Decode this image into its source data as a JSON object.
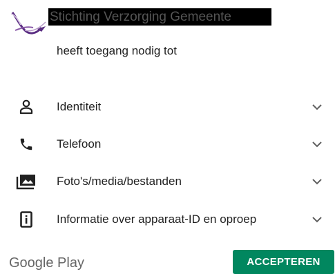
{
  "header": {
    "app_name": "Stichting Verzorging Gemeente",
    "subtitle": "heeft toegang nodig tot"
  },
  "permissions": [
    {
      "label": "Identiteit",
      "icon": "person-icon"
    },
    {
      "label": "Telefoon",
      "icon": "phone-icon"
    },
    {
      "label": "Foto's/media/bestanden",
      "icon": "photos-icon"
    },
    {
      "label": "Informatie over apparaat-ID en oproep",
      "icon": "device-info-icon"
    }
  ],
  "footer": {
    "brand": "Google Play",
    "accept_label": "ACCEPTEREN"
  },
  "colors": {
    "accent_green": "#01875f",
    "logo_purple": "#5a2d82"
  }
}
